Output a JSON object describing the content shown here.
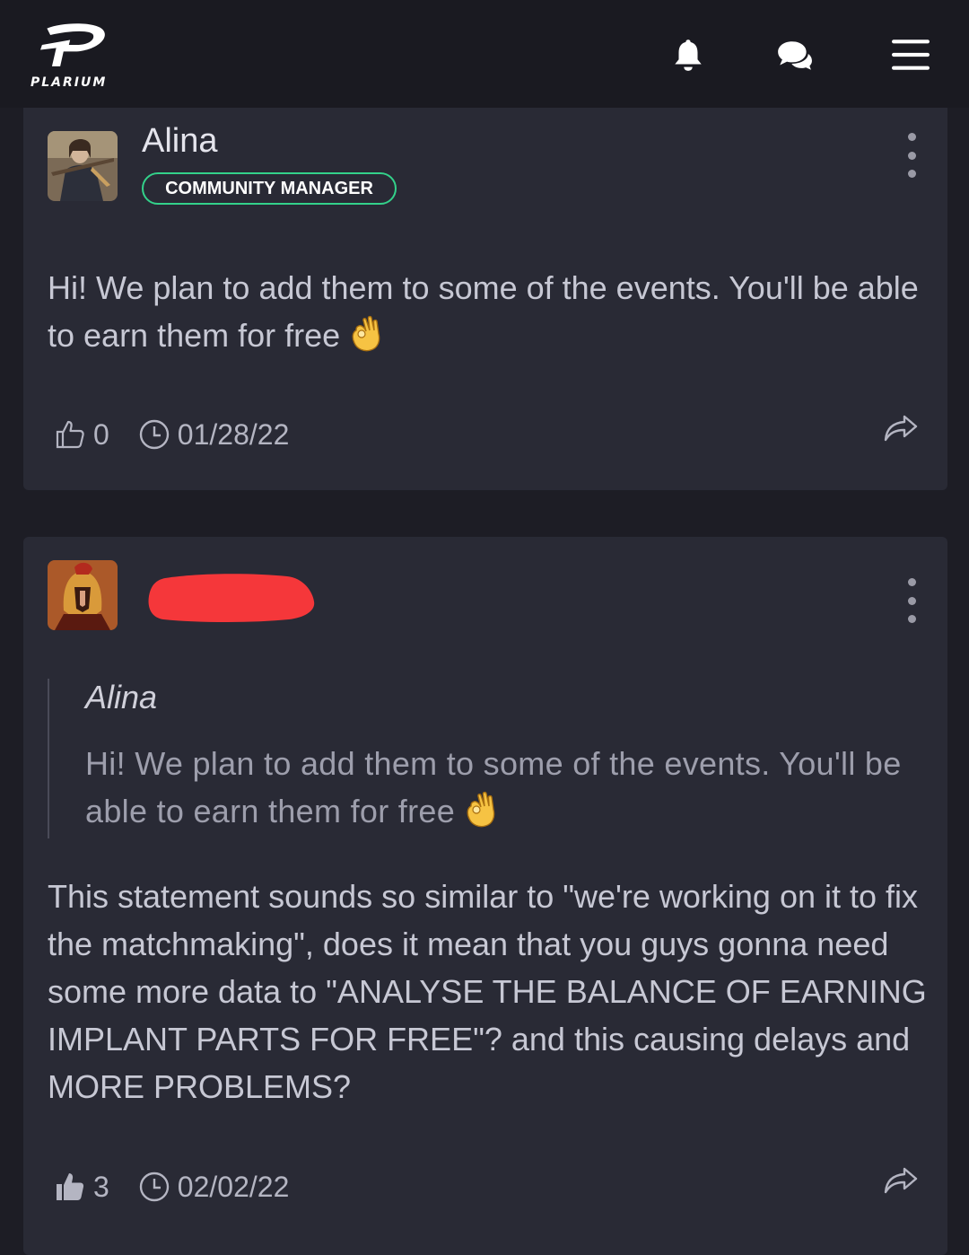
{
  "header": {
    "logo_text": "PLARIUM",
    "icons": [
      "bell-icon",
      "chat-bubbles-icon",
      "hamburger-menu-icon"
    ]
  },
  "posts": [
    {
      "author": "Alina",
      "role_badge": "COMMUNITY MANAGER",
      "body": "Hi! We plan to add them to some of the events. You'll be able to earn them for free",
      "emoji": "ok-hand-emoji",
      "likes": "0",
      "date": "01/28/22"
    },
    {
      "author_redacted": true,
      "quote": {
        "author": "Alina",
        "text": "Hi! We plan to add them to some of the events. You'll be able to earn them for free"
      },
      "body": "This statement sounds so similar to \"we're working on it to fix the matchmaking\", does it mean that you guys gonna need some more data to \"ANALYSE THE BALANCE OF EARNING IMPLANT PARTS FOR FREE\"? and this causing delays and MORE PROBLEMS?",
      "likes": "3",
      "date": "02/02/22"
    }
  ],
  "colors": {
    "background": "#1d1d25",
    "card": "#292a35",
    "badge_border": "#33d18a",
    "redaction": "#f5373a"
  }
}
